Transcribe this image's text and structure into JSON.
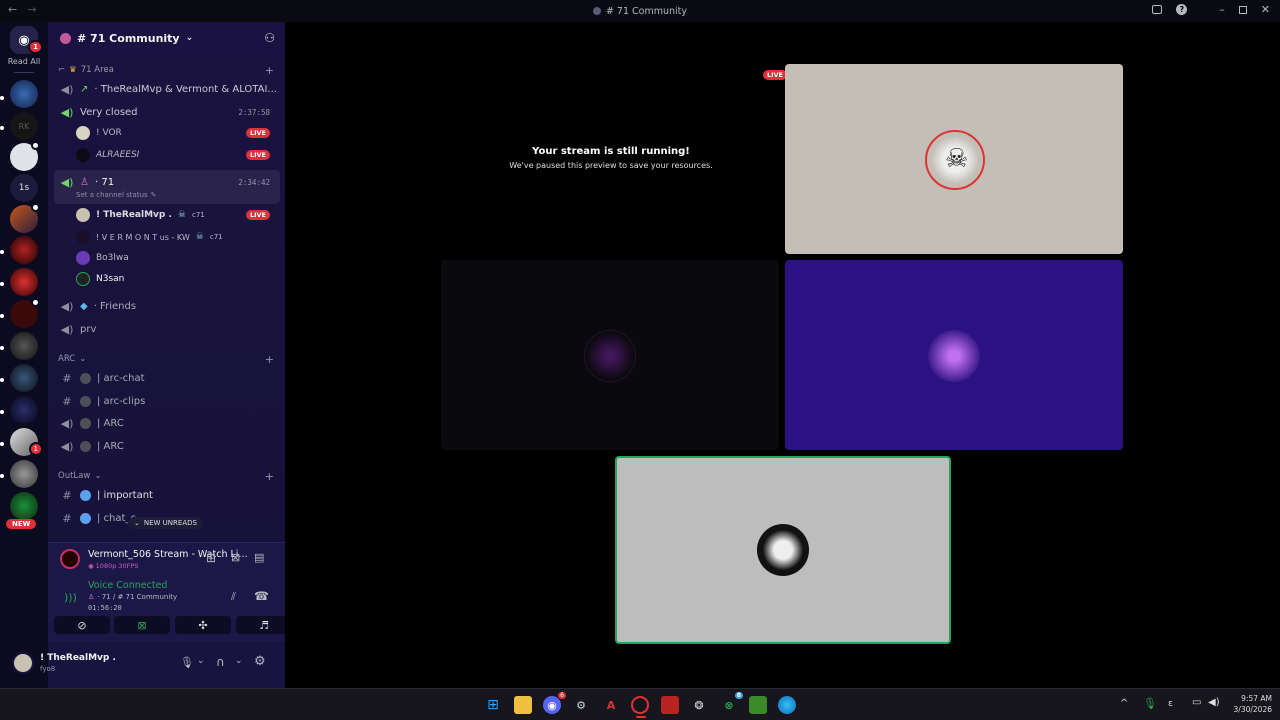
{
  "window": {
    "title": "# 71 Community"
  },
  "guilds": {
    "read_all": "Read All",
    "new_label": "NEW",
    "home_badge": "1",
    "badge_a": "1",
    "text_tile": "1s"
  },
  "server": {
    "name": "# 71 Community"
  },
  "categories": {
    "area": "71 Area",
    "arc": "ARC",
    "outlaw": "OutLaw"
  },
  "channels": {
    "trio": "· TheRealMvp & Vermont & ALOTAI...",
    "very_closed": "Very closed",
    "very_closed_time": "2:37:58",
    "seventy_one": "· 71",
    "seventy_one_time": "2:34:42",
    "set_status": "Set a channel status",
    "friends": "· Friends",
    "prv": "prv",
    "arc_chat": "| arc-chat",
    "arc_clips": "| arc-clips",
    "arc1": "| ARC",
    "arc2": "| ARC",
    "important": "| important",
    "chat_partial": "| chat_c"
  },
  "voice_users": {
    "u1": "! VOR",
    "u2": "ALRAEESI",
    "u3": "! TheRealMvp .",
    "u3_tag": "c71",
    "u4": "! V E R M O N T us - KW",
    "u4_tag": "c71",
    "u5": "Bo3lwa",
    "u6": "N3san",
    "live": "LIVE"
  },
  "new_unreads": "NEW UNREADS",
  "stream_panel": {
    "title": "Vermont_506 Stream - Watch Li...",
    "quality": "1080p 30FPS"
  },
  "voice": {
    "status": "Voice Connected",
    "location": "· 71 / # 71 Community",
    "timer": "01:56:20"
  },
  "user": {
    "name": "! TheRealMvp .",
    "tag": "fyo8"
  },
  "stage": {
    "paused_title": "Your stream is still running!",
    "paused_sub": "We've paused this preview to save your resources.",
    "live": "LIVE"
  },
  "clock": {
    "time": "9:57 AM",
    "date": "3/30/2026"
  },
  "taskbar": {
    "discord_badge": "6",
    "xbox_badge": "8"
  },
  "colors": {
    "accent_live": "#e0313a",
    "voice_green": "#23a55a",
    "purple_tile": "#2a1282"
  }
}
